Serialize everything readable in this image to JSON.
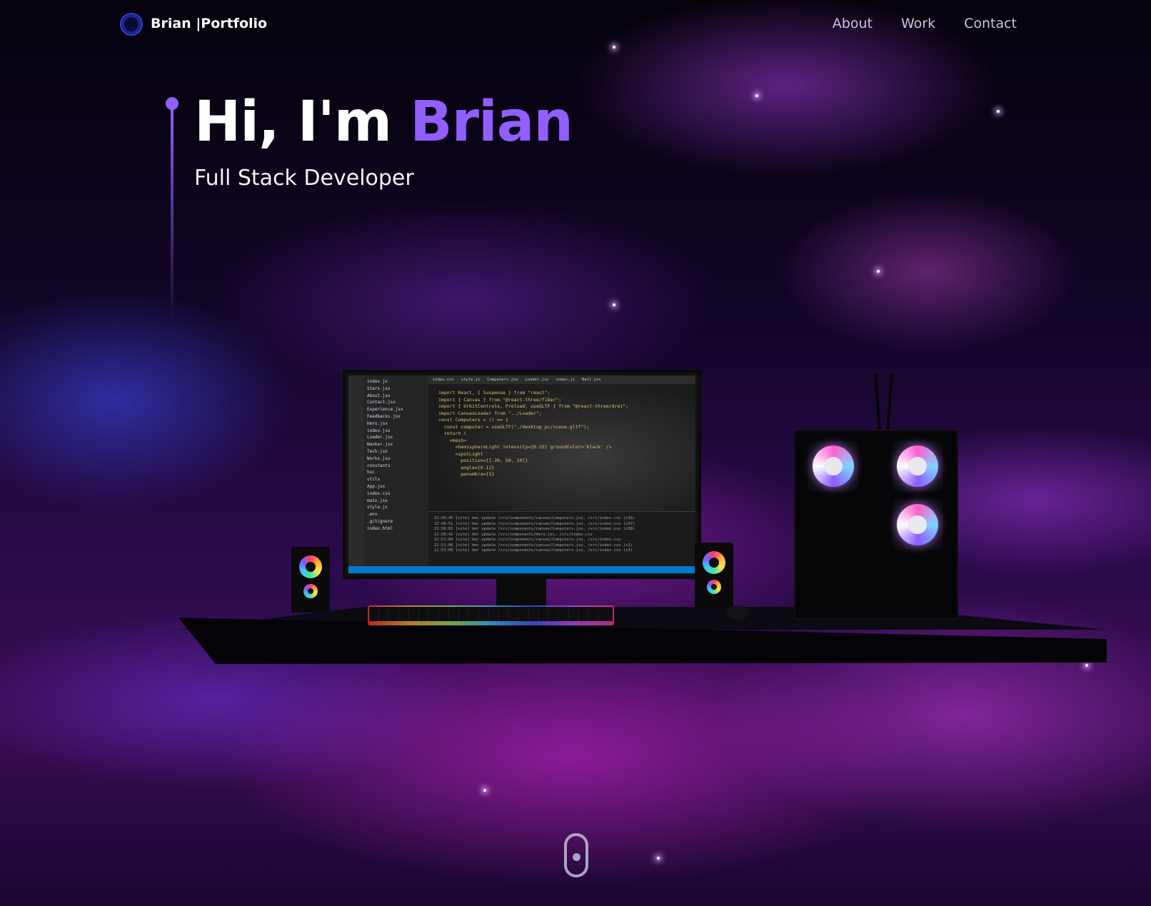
{
  "nav": {
    "brand": "Brian |Portfolio",
    "links": [
      "About",
      "Work",
      "Contact"
    ]
  },
  "hero": {
    "greeting": "Hi, I'm ",
    "name": "Brian",
    "subtitle": "Full Stack Developer"
  },
  "editor": {
    "tabs": [
      "index.css",
      "style.js",
      "Computers.jsx",
      "Loader.jsx",
      "index.js",
      "Ball.jsx"
    ],
    "files": [
      "index.js",
      "Stars.jsx",
      "About.jsx",
      "Contact.jsx",
      "Experience.jsx",
      "Feedbacks.jsx",
      "Hero.jsx",
      "index.jsx",
      "Loader.jsx",
      "Navbar.jsx",
      "Tech.jsx",
      "Works.jsx",
      "constants",
      "hoc",
      "utils",
      "App.jsx",
      "index.css",
      "main.jsx",
      "style.js",
      ".env",
      ".gitignore",
      "index.html"
    ],
    "code_lines": [
      "import React, { Suspense } from \"react\";",
      "import { Canvas } from \"@react-three/fiber\";",
      "import { OrbitControls, Preload, useGLTF } from \"@react-three/drei\";",
      "",
      "import CanvasLoader from \"../Loader\";",
      "",
      "const Computers = () => {",
      "  const computer = useGLTF(\"./desktop_pc/scene.gltf\");",
      "",
      "  return (",
      "    <mesh>",
      "      <hemisphereLight intensity={0.15} groundColor='black' />",
      "      <spotLight",
      "        position={[-20, 50, 10]}",
      "        angle={0.12}",
      "        penumbra={1}"
    ],
    "terminal_lines": [
      "22:49:45 [vite] hmr update /src/components/canvas/Computers.jsx, /src/index.css (x36)",
      "22:49:51 [vite] hmr update /src/components/canvas/Computers.jsx, /src/index.css (x37)",
      "22:50:02 [vite] hmr update /src/components/canvas/Computers.jsx, /src/index.css (x38)",
      "22:50:42 [vite] hmr update /src/components/Hero.jsx, /src/index.css",
      "22:51:04 [vite] hmr update /src/components/canvas/Computers.jsx, /src/index.css",
      "22:51:06 [vite] hmr update /src/components/canvas/Computers.jsx, /src/index.css (x2)",
      "22:51:09 [vite] hmr update /src/components/canvas/Computers.jsx, /src/index.css (x3)"
    ]
  },
  "colors": {
    "accent": "#915eff",
    "background": "#07030f",
    "nav_link": "#c9c6d8"
  },
  "icons": {
    "logo": "circle-logo-icon",
    "scroll": "mouse-scroll-icon"
  }
}
